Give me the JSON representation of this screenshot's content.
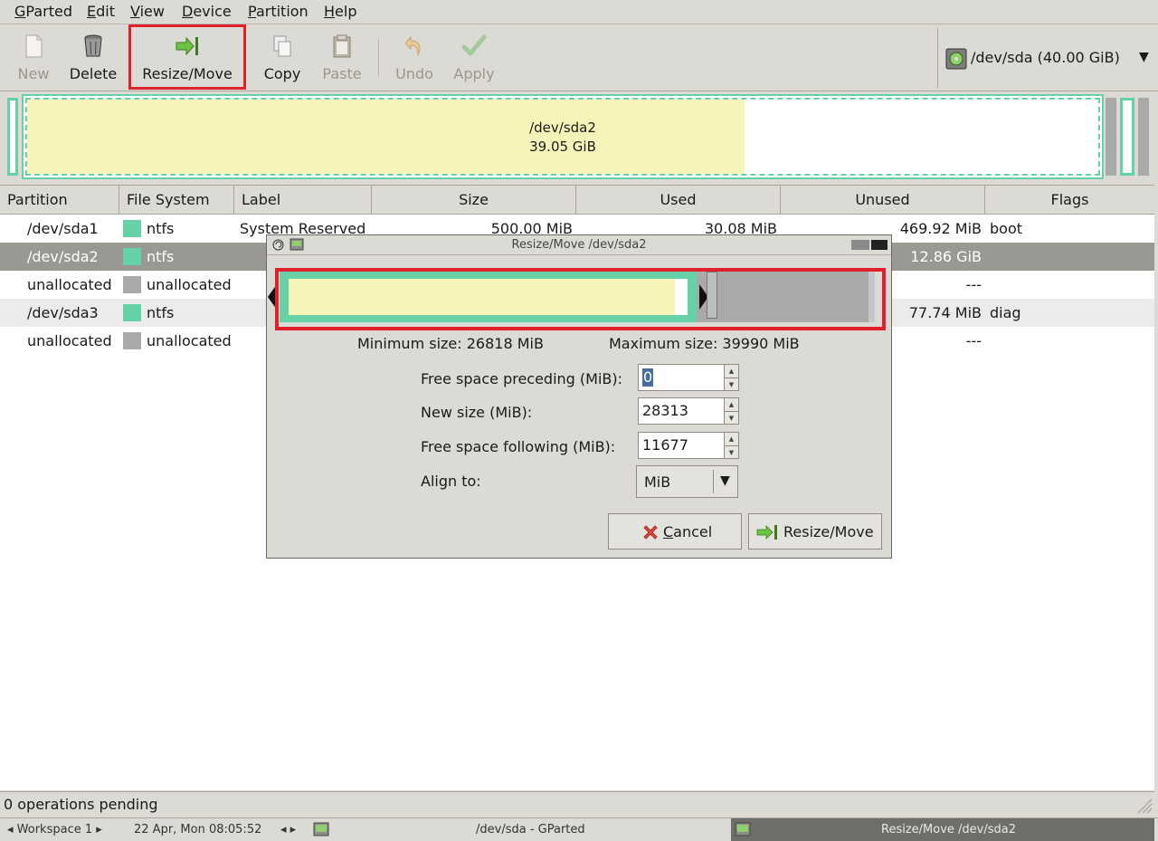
{
  "menubar": {
    "items": [
      {
        "label": "GParted",
        "underline": "G",
        "rest": "Parted"
      },
      {
        "label": "Edit",
        "underline": "E",
        "rest": "dit"
      },
      {
        "label": "View",
        "underline": "V",
        "rest": "iew"
      },
      {
        "label": "Device",
        "underline": "D",
        "rest": "evice"
      },
      {
        "label": "Partition",
        "underline": "P",
        "rest": "artition"
      },
      {
        "label": "Help",
        "underline": "H",
        "rest": "elp"
      }
    ]
  },
  "toolbar": {
    "new_label": "New",
    "delete_label": "Delete",
    "resize_label": "Resize/Move",
    "copy_label": "Copy",
    "paste_label": "Paste",
    "undo_label": "Undo",
    "apply_label": "Apply",
    "device_label": "/dev/sda  (40.00 GiB)"
  },
  "diskmap": {
    "partition_name": "/dev/sda2",
    "partition_size": "39.05 GiB",
    "used_fraction": 0.67
  },
  "table": {
    "headers": [
      "Partition",
      "File System",
      "Label",
      "Size",
      "Used",
      "Unused",
      "Flags"
    ],
    "rows": [
      {
        "partition": "/dev/sda1",
        "fs": "ntfs",
        "label": "System Reserved",
        "size": "500.00 MiB",
        "used": "30.08 MiB",
        "unused": "469.92 MiB",
        "flags": "boot"
      },
      {
        "partition": "/dev/sda2",
        "fs": "ntfs",
        "label": "",
        "size": "",
        "used": "",
        "unused": "12.86 GiB",
        "flags": ""
      },
      {
        "partition": "unallocated",
        "fs": "unallocated",
        "label": "",
        "size": "",
        "used": "",
        "unused": "---",
        "flags": ""
      },
      {
        "partition": "/dev/sda3",
        "fs": "ntfs",
        "label": "",
        "size": "",
        "used": "",
        "unused": "77.74 MiB",
        "flags": "diag"
      },
      {
        "partition": "unallocated",
        "fs": "unallocated",
        "label": "",
        "size": "",
        "used": "",
        "unused": "---",
        "flags": ""
      }
    ]
  },
  "status": {
    "operations": "0 operations pending"
  },
  "taskbar": {
    "workspace": "◂ Workspace 1 ▸",
    "datetime": "22 Apr, Mon 08:05:52",
    "nav": "◂ ▸",
    "window1": "/dev/sda - GParted",
    "window2": "Resize/Move /dev/sda2"
  },
  "dialog": {
    "title": "Resize/Move /dev/sda2",
    "min_size": "Minimum size: 26818 MiB",
    "max_size": "Maximum size: 39990 MiB",
    "preceding_label": "Free space preceding (MiB):",
    "preceding_value": "0",
    "new_size_label": "New size (MiB):",
    "new_size_value": "28313",
    "following_label": "Free space following (MiB):",
    "following_value": "11677",
    "align_label": "Align to:",
    "align_value": "MiB",
    "cancel_label": "Cancel",
    "resize_label": "Resize/Move"
  },
  "colors": {
    "ntfs": "#66d1a7",
    "unallocated": "#a9a9a9",
    "used": "#f6f4b8",
    "highlight": "#e0202a",
    "selected_row": "#9a9893"
  }
}
